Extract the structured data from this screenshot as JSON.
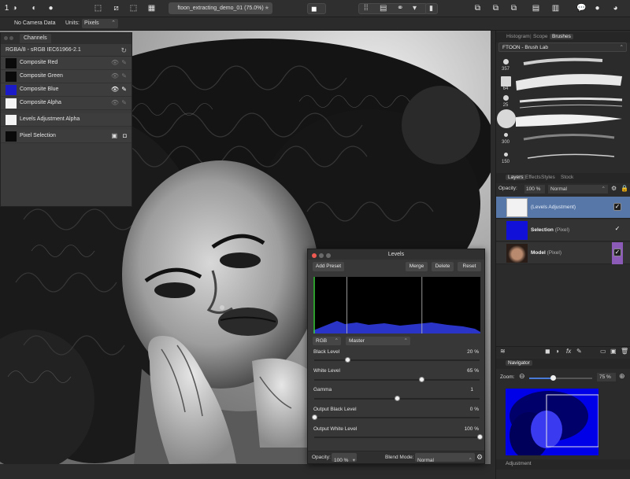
{
  "toolbar": {
    "doc_title": "ftoon_extracting_demo_01 (75.0%)",
    "star": "★"
  },
  "context": {
    "persona_number": "1",
    "camera_data": "No Camera Data",
    "units_label": "Units:",
    "units_value": "Pixels"
  },
  "channels": {
    "tab": "Channels",
    "profile": "RGBA/8 - sRGB IEC61966-2.1",
    "rows": [
      {
        "label": "Composite Red",
        "color": "#0a0a0a"
      },
      {
        "label": "Composite Green",
        "color": "#0a0a0a"
      },
      {
        "label": "Composite Blue",
        "color": "#1b1bc8"
      },
      {
        "label": "Composite Alpha",
        "color": "#f4f4f4"
      }
    ],
    "levels_alpha": "Levels Adjustment Alpha",
    "pixel_selection": "Pixel Selection"
  },
  "levels": {
    "title": "Levels",
    "add_preset": "Add Preset",
    "merge": "Merge",
    "delete": "Delete",
    "reset": "Reset",
    "channel": "RGB",
    "preset": "Master",
    "black_label": "Black Level",
    "black_value": "20 %",
    "black_level": 0.2,
    "white_label": "White Level",
    "white_value": "65 %",
    "white_level": 0.65,
    "gamma_label": "Gamma",
    "gamma_value": "1",
    "gamma_level": 0.5,
    "out_black_label": "Output Black Level",
    "out_black_value": "0 %",
    "out_black_level": 0.0,
    "out_white_label": "Output White Level",
    "out_white_value": "100 %",
    "out_white_level": 1.0,
    "opacity_label": "Opacity:",
    "opacity_value": "100 %",
    "blend_label": "Blend Mode:",
    "blend_value": "Normal"
  },
  "right": {
    "tabs_top": [
      "Histogram",
      "Scope",
      "Brushes"
    ],
    "brush_category": "FTOON - Brush Lab",
    "brush_sizes": [
      "357",
      "64",
      "25",
      "300",
      "150"
    ],
    "tabs_layers": [
      "Layers",
      "Effects",
      "Styles",
      "Stock"
    ],
    "opacity_label": "Opacity:",
    "opacity_value": "100 %",
    "blend_value": "Normal",
    "layers": [
      {
        "name": "(Levels Adjustment)",
        "kind": "",
        "checked": true
      },
      {
        "name": "Selection",
        "kind": "(Pixel)",
        "checked": true
      },
      {
        "name": "Model",
        "kind": "(Pixel)",
        "checked": true
      }
    ],
    "navigator_tab": "Navigator",
    "zoom_label": "Zoom:",
    "zoom_value": "75 %",
    "adjustment_tab": "Adjustment"
  },
  "colors": {
    "accent_blue": "#1b1bc8",
    "selection_blue": "#5677a8",
    "purple_tag": "#8c5bb8"
  }
}
